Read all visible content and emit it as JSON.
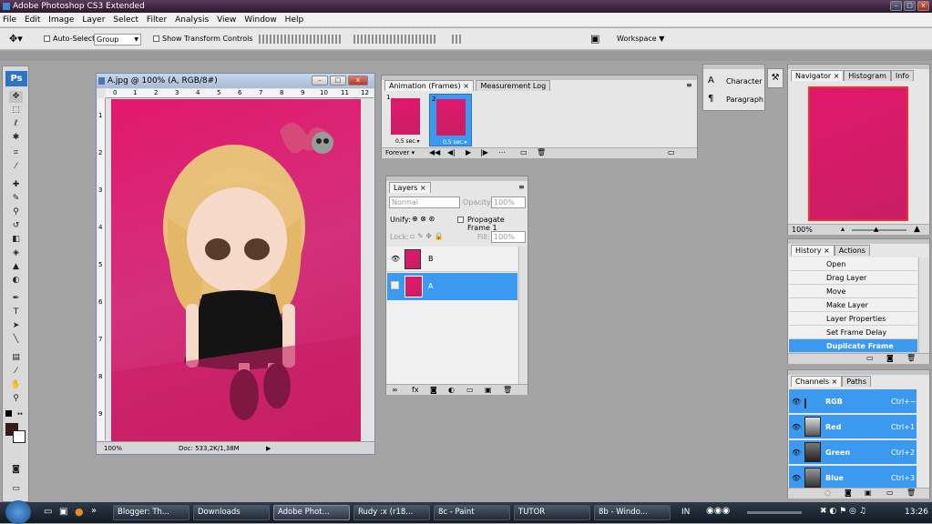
{
  "titlebar": {
    "title": "Adobe Photoshop CS3 Extended",
    "min": "–",
    "max": "□",
    "close": "x"
  },
  "menu": [
    "File",
    "Edit",
    "Image",
    "Layer",
    "Select",
    "Filter",
    "Analysis",
    "View",
    "Window",
    "Help"
  ],
  "options": {
    "auto_select_label": "Auto-Select:",
    "auto_select_value": "Group",
    "transform_label": "Show Transform Controls",
    "workspace_label": "Workspace"
  },
  "toolbox": {
    "logo": "Ps"
  },
  "document": {
    "title": "A.jpg @ 100% (A, RGB/8#)",
    "ruler_h": [
      "0",
      "1",
      "2",
      "3",
      "4",
      "5",
      "6",
      "7",
      "8",
      "9",
      "10",
      "11",
      "12"
    ],
    "ruler_v": [
      "1",
      "2",
      "3",
      "4",
      "5",
      "6",
      "7",
      "8",
      "9"
    ],
    "zoom": "100%",
    "doc_info": "Doc: 533,2K/1,38M"
  },
  "animation": {
    "tabs": [
      "Animation (Frames)",
      "Measurement Log"
    ],
    "frames": [
      {
        "num": "1",
        "delay": "0,5 sec."
      },
      {
        "num": "2",
        "delay": "0,5 sec."
      }
    ],
    "loop": "Forever"
  },
  "layers": {
    "tab": "Layers",
    "blend_mode": "Normal",
    "opacity_label": "Opacity:",
    "opacity": "100%",
    "unify_label": "Unify:",
    "propagate_label": "Propagate Frame 1",
    "lock_label": "Lock:",
    "fill_label": "Fill:",
    "fill": "100%",
    "items": [
      {
        "name": "B",
        "selected": false
      },
      {
        "name": "A",
        "selected": true
      }
    ]
  },
  "char_panel": {
    "items": [
      "Character",
      "Paragraph"
    ]
  },
  "navigator": {
    "tabs": [
      "Navigator",
      "Histogram",
      "Info"
    ],
    "zoom": "100%"
  },
  "history": {
    "tabs": [
      "History",
      "Actions"
    ],
    "items": [
      "Open",
      "Drag Layer",
      "Move",
      "Make Layer",
      "Layer Properties",
      "Set Frame Delay",
      "Duplicate Frame"
    ]
  },
  "channels": {
    "tabs": [
      "Channels",
      "Paths"
    ],
    "items": [
      {
        "name": "RGB",
        "shortcut": "Ctrl+~"
      },
      {
        "name": "Red",
        "shortcut": "Ctrl+1"
      },
      {
        "name": "Green",
        "shortcut": "Ctrl+2"
      },
      {
        "name": "Blue",
        "shortcut": "Ctrl+3"
      }
    ]
  },
  "taskbar": {
    "items": [
      "Blogger: Th...",
      "Downloads",
      "Adobe Phot...",
      "Rudy :x (r18...",
      "8c - Paint",
      "TUTOR",
      "8b - Windo..."
    ],
    "lang": "IN",
    "clock": "13:26"
  },
  "colors": {
    "accent": "#3b9af0",
    "canvas": "#e2186d",
    "taskbar": "#1a2330"
  }
}
